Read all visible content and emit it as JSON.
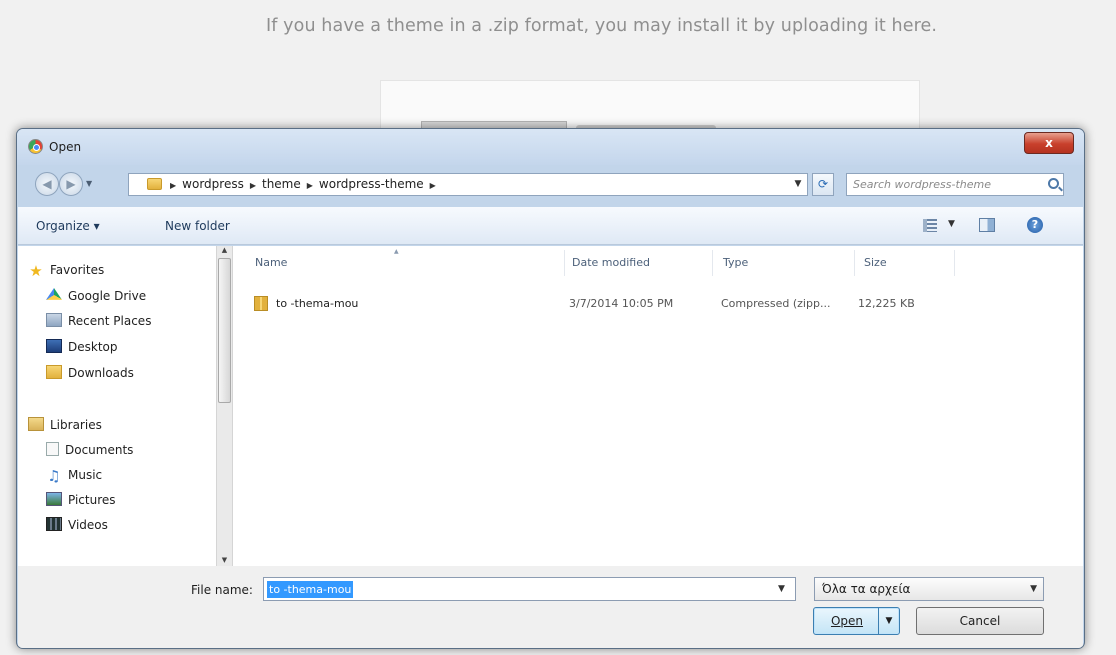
{
  "background": {
    "instruction": "If you have a theme in a .zip format, you may install it by uploading it here."
  },
  "dialog": {
    "title": "Open",
    "close_label": "x",
    "address": {
      "crumbs": [
        "wordpress",
        "theme",
        "wordpress-theme"
      ]
    },
    "search": {
      "placeholder": "Search wordpress-theme"
    },
    "toolbar": {
      "organize_label": "Organize ▾",
      "new_folder_label": "New folder"
    },
    "nav": {
      "favorites_label": "Favorites",
      "google_drive": "Google Drive",
      "recent_places": "Recent Places",
      "desktop": "Desktop",
      "downloads": "Downloads",
      "libraries_label": "Libraries",
      "documents": "Documents",
      "music": "Music",
      "pictures": "Pictures",
      "videos": "Videos"
    },
    "columns": {
      "name": "Name",
      "date_modified": "Date modified",
      "type": "Type",
      "size": "Size"
    },
    "files": [
      {
        "name": "to -thema-mou",
        "date": "3/7/2014 10:05 PM",
        "type": "Compressed (zipp...",
        "size": "12,225 KB"
      }
    ],
    "footer": {
      "file_name_label": "File name:",
      "file_name_value": "to -thema-mou",
      "filter_value": "Όλα τα αρχεία",
      "open_label": "Open",
      "cancel_label": "Cancel"
    }
  }
}
